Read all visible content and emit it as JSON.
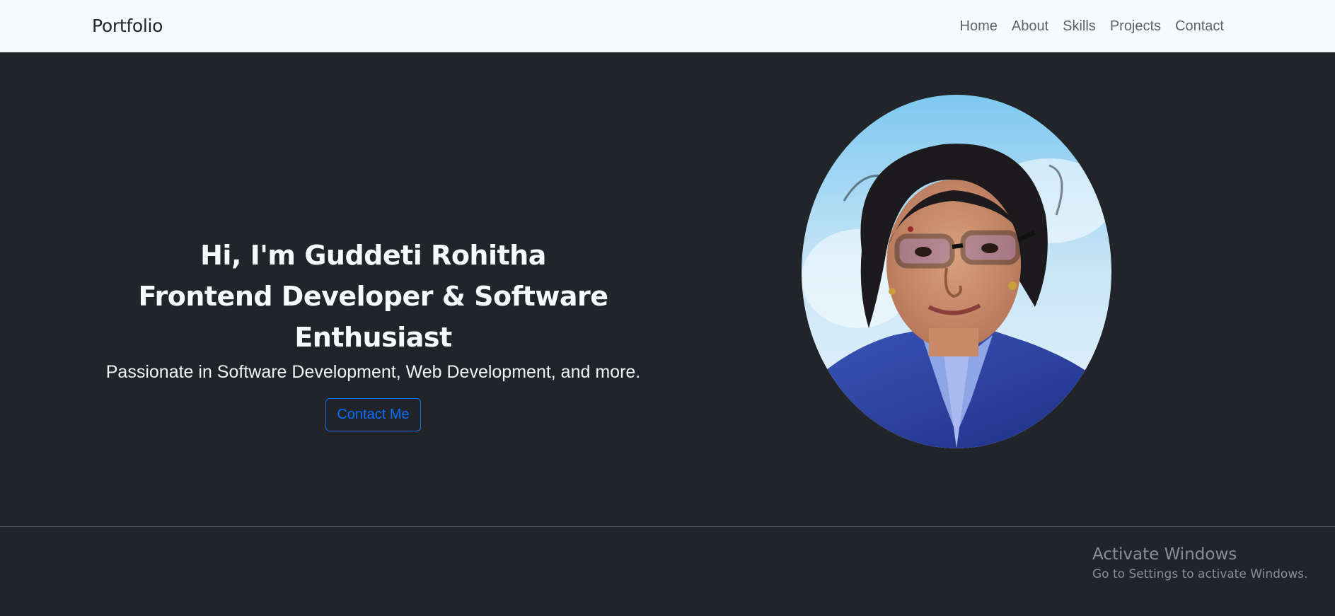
{
  "navbar": {
    "brand": "Portfolio",
    "links": [
      "Home",
      "About",
      "Skills",
      "Projects",
      "Contact"
    ]
  },
  "hero": {
    "greeting": "Hi, I'm Guddeti Rohitha",
    "role": "Frontend Developer & Software Enthusiast",
    "tagline": "Passionate in Software Development, Web Development, and more.",
    "cta_label": "Contact Me"
  },
  "watermark": {
    "title": "Activate Windows",
    "subtitle": "Go to Settings to activate Windows."
  },
  "colors": {
    "navbar_bg": "#f8f9fa",
    "hero_bg": "#212529",
    "primary": "#0d6efd",
    "nav_text": "#5c636a"
  }
}
